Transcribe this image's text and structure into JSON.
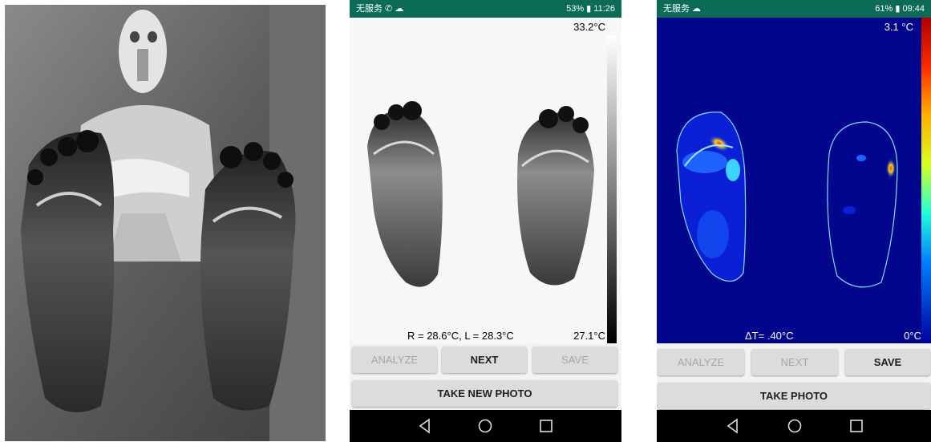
{
  "thermal_phone": {
    "status_left": "无服务 ✆ ☁",
    "status_right": "53% ▮ 11:26",
    "temp_max": "33.2°C",
    "temp_min": "27.1°C",
    "readout": "R = 28.6°C, L = 28.3°C",
    "buttons": {
      "analyze": "ANALYZE",
      "next": "NEXT",
      "save": "SAVE",
      "take_photo": "TAKE NEW PHOTO"
    }
  },
  "analysis_phone": {
    "status_left": "无服务 ☁",
    "status_right": "61% ▮ 09:44",
    "temp_max": "3.1 °C",
    "temp_min": "0°C",
    "delta_t": "ΔT= .40°C",
    "buttons": {
      "analyze": "ANALYZE",
      "next": "NEXT",
      "save": "SAVE",
      "take_photo": "TAKE PHOTO"
    }
  },
  "icons": [
    "back-icon",
    "home-icon",
    "recents-icon"
  ],
  "colors": {
    "status_bar": "#0c6b57",
    "heatmap_bg": "#02068c",
    "button": "#dcdcdc"
  }
}
